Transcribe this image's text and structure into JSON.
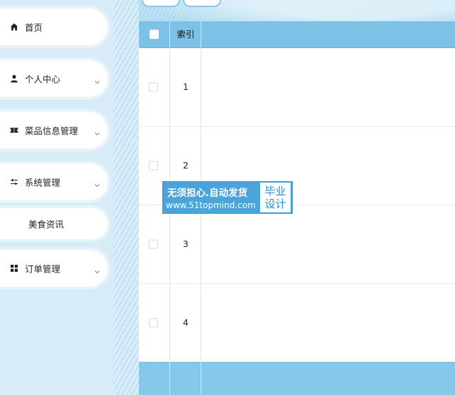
{
  "sidebar": {
    "items": [
      {
        "label": "首页",
        "icon": "home-icon",
        "expandable": false
      },
      {
        "label": "个人中心",
        "icon": "user-icon",
        "expandable": true
      },
      {
        "label": "菜品信息管理",
        "icon": "ticket-icon",
        "expandable": true
      },
      {
        "label": "系统管理",
        "icon": "sliders-icon",
        "expandable": true
      },
      {
        "label": "美食资讯",
        "icon": "",
        "expandable": false
      },
      {
        "label": "订单管理",
        "icon": "grid-icon",
        "expandable": true
      }
    ]
  },
  "table": {
    "header": {
      "index_label": "索引"
    },
    "rows": [
      {
        "index": "1"
      },
      {
        "index": "2"
      },
      {
        "index": "3"
      },
      {
        "index": "4"
      }
    ]
  },
  "watermark": {
    "line1": "无须担心.自动发货",
    "line2": "www.51topmind.com",
    "badge_line1": "毕业",
    "badge_line2": "设计"
  },
  "colors": {
    "accent": "#7dc2e6",
    "watermark": "#4aa3d9"
  }
}
